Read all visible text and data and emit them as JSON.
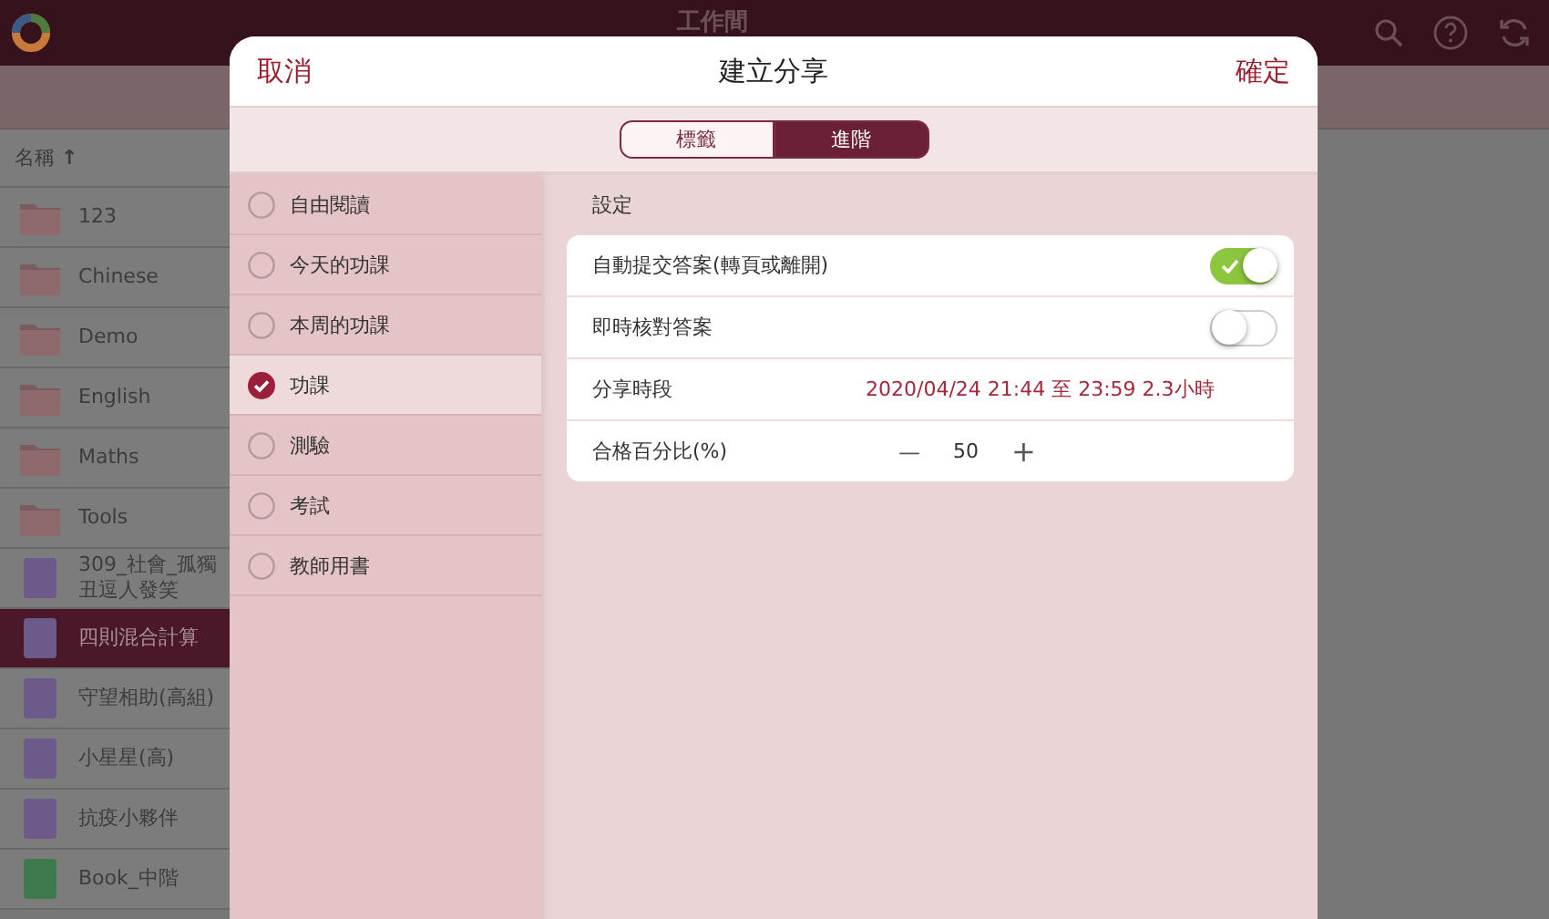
{
  "app_bar": {
    "title": "工作間"
  },
  "file_list": {
    "sort_header": "名稱",
    "sort_arrow": "↑",
    "rows": [
      {
        "kind": "folder",
        "name": "123",
        "selected": false
      },
      {
        "kind": "folder",
        "name": "Chinese",
        "selected": false
      },
      {
        "kind": "folder",
        "name": "Demo",
        "selected": false
      },
      {
        "kind": "folder",
        "name": "English",
        "selected": false
      },
      {
        "kind": "folder",
        "name": "Maths",
        "selected": false
      },
      {
        "kind": "folder",
        "name": "Tools",
        "selected": false
      },
      {
        "kind": "book",
        "name": "309_社會_孤獨",
        "name_line_2": "丑逗人發笑",
        "color": "#6b5a8a",
        "selected": false
      },
      {
        "kind": "book",
        "name": "四則混合計算",
        "color": "#6b5a8a",
        "selected": true
      },
      {
        "kind": "book",
        "name": "守望相助(高組)",
        "color": "#6b5a8a",
        "selected": false
      },
      {
        "kind": "book",
        "name": "小星星(高)",
        "color": "#6b5a8a",
        "selected": false
      },
      {
        "kind": "book",
        "name": "抗疫小夥伴",
        "color": "#6b5a8a",
        "selected": false
      },
      {
        "kind": "book",
        "name": "Book_中階",
        "color": "#3f7a4c",
        "selected": false
      }
    ]
  },
  "dialog": {
    "cancel": "取消",
    "title": "建立分享",
    "confirm": "確定",
    "tabs": [
      {
        "label": "標籤",
        "selected": false
      },
      {
        "label": "進階",
        "selected": true
      }
    ],
    "categories": [
      {
        "label": "自由閱讀",
        "selected": false
      },
      {
        "label": "今天的功課",
        "selected": false
      },
      {
        "label": "本周的功課",
        "selected": false
      },
      {
        "label": "功課",
        "selected": true
      },
      {
        "label": "測驗",
        "selected": false
      },
      {
        "label": "考試",
        "selected": false
      },
      {
        "label": "教師用書",
        "selected": false
      }
    ],
    "settings_heading": "設定",
    "settings": [
      {
        "kind": "toggle",
        "label": "自動提交答案(轉頁或離開)",
        "on": true
      },
      {
        "kind": "toggle",
        "label": "即時核對答案",
        "on": false
      },
      {
        "kind": "period",
        "label": "分享時段",
        "value": "2020/04/24 21:44 至 23:59 2.3小時"
      },
      {
        "kind": "stepper",
        "label": "合格百分比(%)",
        "minus": "—",
        "value": "50",
        "plus": "+"
      }
    ]
  }
}
